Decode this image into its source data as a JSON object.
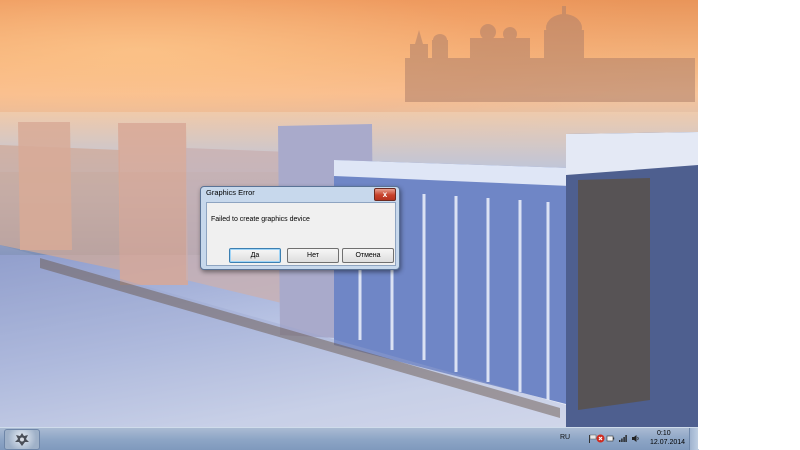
{
  "dialog": {
    "title": "Graphics Error",
    "close_label": "x",
    "message": "Failed to create graphics device",
    "buttons": {
      "yes": "Да",
      "no": "Нет",
      "cancel": "Отмена"
    }
  },
  "taskbar": {
    "language": "RU",
    "time": "0:10",
    "date": "12.07.2014",
    "tray_icons": [
      "flag-icon",
      "network-icon",
      "power-icon",
      "volume-icon"
    ]
  },
  "colors": {
    "taskbar": "#8ea6c6",
    "dialog_frame": "#c7d8ec",
    "close_button": "#c7412b"
  }
}
